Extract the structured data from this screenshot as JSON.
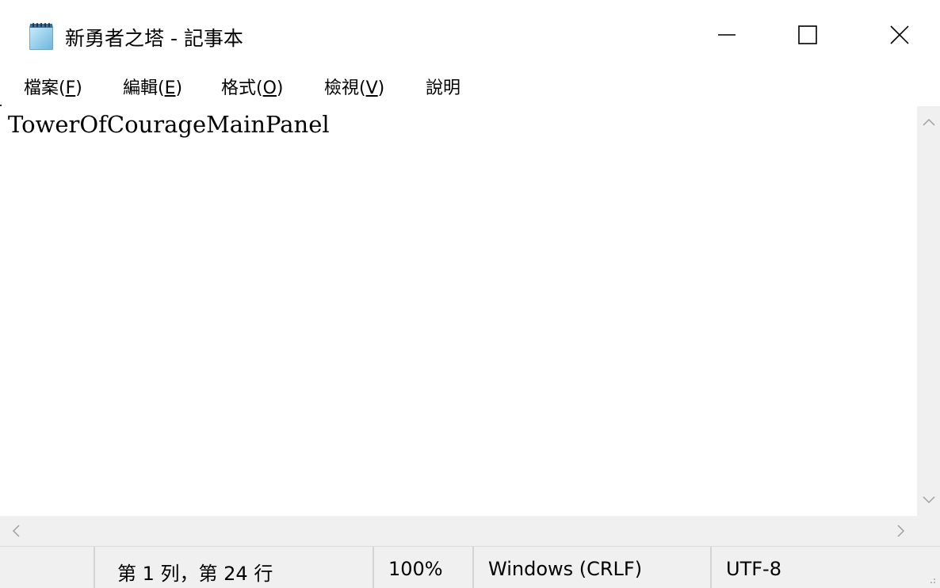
{
  "window": {
    "title": "新勇者之塔 - 記事本",
    "controls": {
      "minimize": "—",
      "maximize": "☐",
      "close": "✕"
    }
  },
  "menu": [
    {
      "text": "檔案(",
      "key": "F",
      "suffix": ")"
    },
    {
      "text": "編輯(",
      "key": "E",
      "suffix": ")"
    },
    {
      "text": "格式(",
      "key": "O",
      "suffix": ")"
    },
    {
      "text": "檢視(",
      "key": "V",
      "suffix": ")"
    },
    {
      "text": "說明",
      "key": "",
      "suffix": ""
    }
  ],
  "editor": {
    "content": "TowerOfCourageMainPanel"
  },
  "status": {
    "position": "第 1 列，第 24 行",
    "zoom": "100%",
    "line_ending": "Windows (CRLF)",
    "encoding": "UTF-8"
  },
  "icons": {
    "app": "notepad-icon",
    "scroll_up": "chevron-up-icon",
    "scroll_down": "chevron-down-icon",
    "scroll_left": "chevron-left-icon",
    "scroll_right": "chevron-right-icon",
    "grip": "resize-grip-icon"
  }
}
